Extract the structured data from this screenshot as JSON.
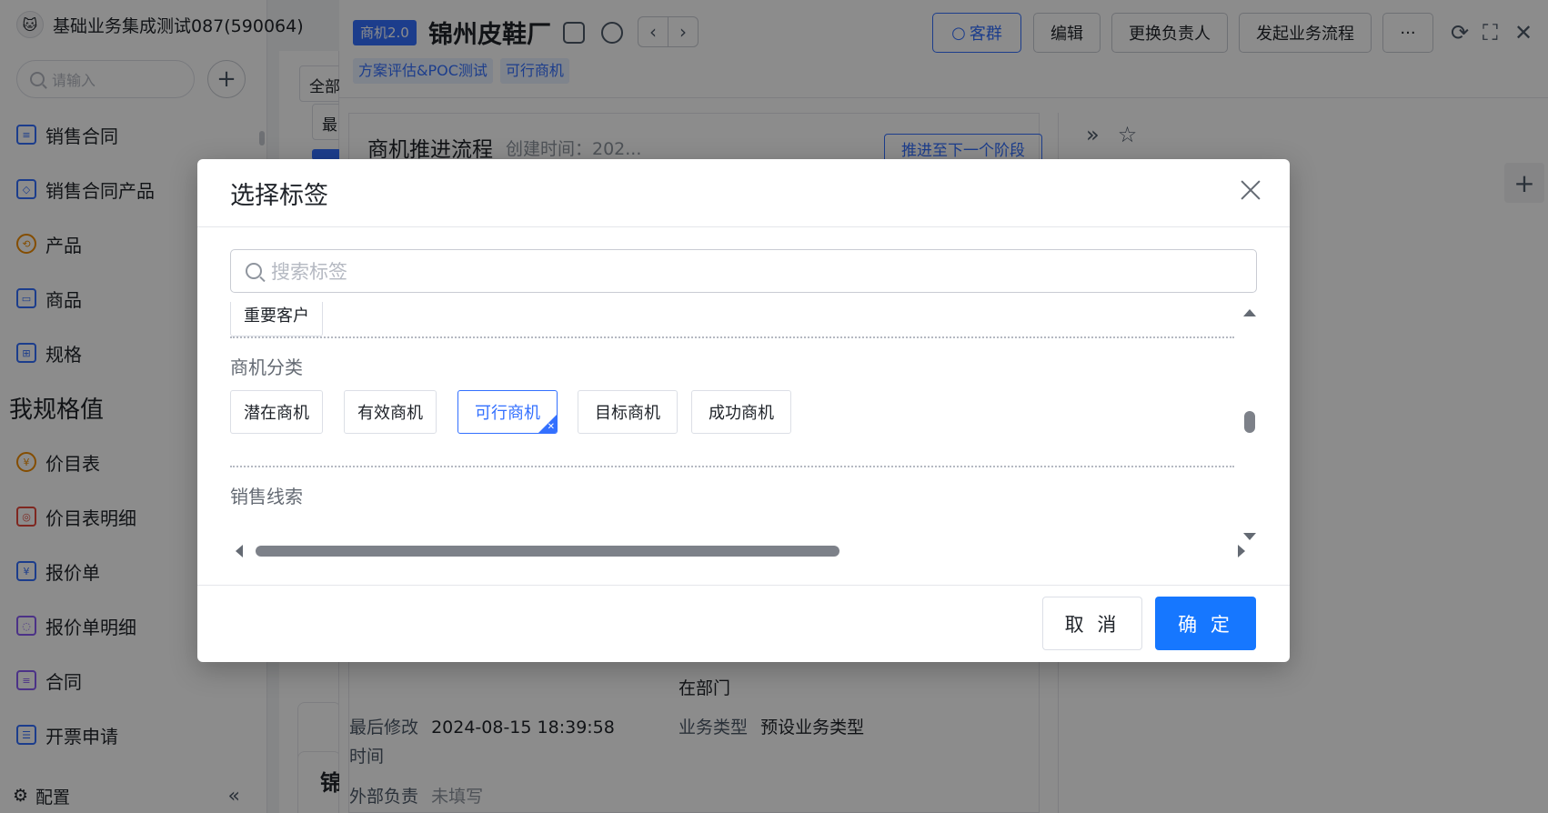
{
  "app": {
    "title": "基础业务集成测试087(590064)",
    "logo": "🐱"
  },
  "sidebar": {
    "search_placeholder": "请输入",
    "items": [
      {
        "label": "销售合同",
        "icon": "contract-icon"
      },
      {
        "label": "销售合同产品",
        "icon": "product-box-icon"
      },
      {
        "label": "产品",
        "icon": "product-icon"
      },
      {
        "label": "商品",
        "icon": "goods-icon"
      },
      {
        "label": "规格",
        "icon": "spec-icon"
      }
    ],
    "group_label": "我规格值",
    "items2": [
      {
        "label": "价目表",
        "icon": "price-list-icon"
      },
      {
        "label": "价目表明细",
        "icon": "price-detail-icon"
      },
      {
        "label": "报价单",
        "icon": "quote-icon"
      },
      {
        "label": "报价单明细",
        "icon": "quote-detail-icon"
      },
      {
        "label": "合同",
        "icon": "contract-doc-icon"
      },
      {
        "label": "开票申请",
        "icon": "invoice-icon"
      }
    ],
    "settings_label": "配置"
  },
  "midcol": {
    "filter_label": "全部",
    "filter2_label": "最",
    "card_char": "锦"
  },
  "record": {
    "version_tag": "商机2.0",
    "title": "锦州皮鞋厂",
    "subtags": [
      "方案评估&POC测试",
      "可行商机"
    ],
    "buttons": {
      "kequn": "客群",
      "edit": "编辑",
      "change_owner": "更换负责人",
      "start_flow": "发起业务流程",
      "more": "···"
    }
  },
  "detail": {
    "flow_title": "商机推进流程",
    "created_label": "创建时间：202...",
    "next_stage_button": "推进至下一个阶段",
    "dept_value": "在部门",
    "last_modified_label": "最后修改",
    "last_modified_label2": "时间",
    "last_modified_value": "2024-08-15 18:39:58",
    "biz_type_label": "业务类型",
    "biz_type_value": "预设业务类型",
    "external_owner_label": "外部负责",
    "external_owner_value": "未填写"
  },
  "modal": {
    "title": "选择标签",
    "search_placeholder": "搜索标签",
    "group0_chip": "重要客户",
    "group1_label": "商机分类",
    "group1_chips": [
      "潜在商机",
      "有效商机",
      "可行商机",
      "目标商机",
      "成功商机"
    ],
    "group1_selected": "可行商机",
    "group2_label": "销售线索",
    "cancel_label": "取 消",
    "ok_label": "确 定"
  },
  "colors": {
    "primary": "#1677ff",
    "accent": "#3370ff",
    "mask": "rgba(0,0,0,0.45)"
  }
}
